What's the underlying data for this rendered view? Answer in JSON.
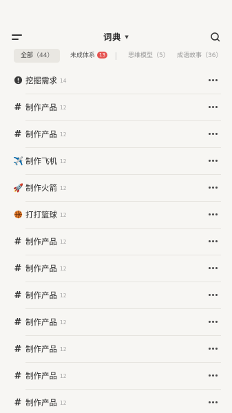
{
  "header": {
    "title": "词典",
    "menu_icon": "menu-icon",
    "dropdown_icon": "chevron-down-icon",
    "search_icon": "search-icon"
  },
  "tabs": [
    {
      "label": "全部",
      "count": "（44）",
      "active": true
    },
    {
      "label": "未成体系",
      "badge": "13"
    },
    {
      "label": "思维模型",
      "count": "（5）"
    },
    {
      "label": "成语故事",
      "count": "（36）"
    }
  ],
  "colors": {
    "background": "#F7F6F3",
    "badge": "#E5524F",
    "active_tab": "#E9E7E2"
  },
  "items": [
    {
      "icon": "alert-circle-icon",
      "name": "挖掘需求",
      "count": "14"
    },
    {
      "icon": "hash-icon",
      "name": "制作产品",
      "count": "12"
    },
    {
      "icon": "hash-icon",
      "name": "制作产品",
      "count": "12"
    },
    {
      "icon": "airplane-icon",
      "name": "制作飞机",
      "count": "12"
    },
    {
      "icon": "rocket-icon",
      "name": "制作火箭",
      "count": "12"
    },
    {
      "icon": "basketball-icon",
      "name": "打打篮球",
      "count": "12"
    },
    {
      "icon": "hash-icon",
      "name": "制作产品",
      "count": "12"
    },
    {
      "icon": "hash-icon",
      "name": "制作产品",
      "count": "12"
    },
    {
      "icon": "hash-icon",
      "name": "制作产品",
      "count": "12"
    },
    {
      "icon": "hash-icon",
      "name": "制作产品",
      "count": "12"
    },
    {
      "icon": "hash-icon",
      "name": "制作产品",
      "count": "12"
    },
    {
      "icon": "hash-icon",
      "name": "制作产品",
      "count": "12"
    },
    {
      "icon": "hash-icon",
      "name": "制作产品",
      "count": "12"
    }
  ]
}
